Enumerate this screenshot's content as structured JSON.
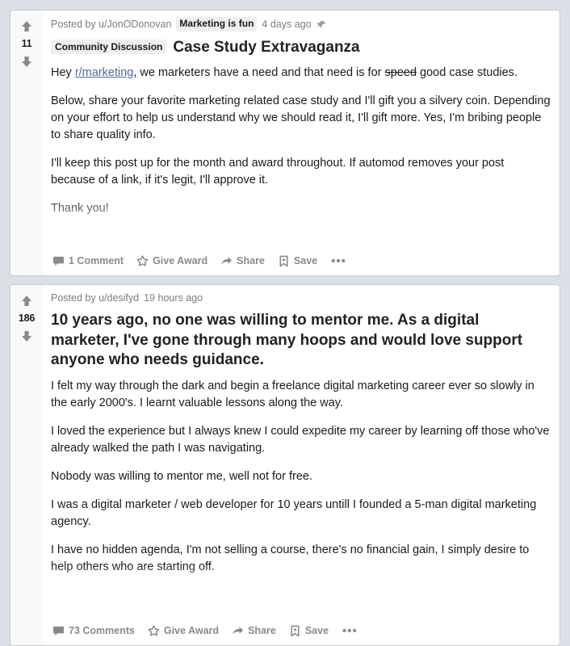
{
  "background_color": "#dae0e6",
  "card_color": "#ffffff",
  "link_color": "#4f6a9c",
  "muted_color": "#878a8c",
  "posts": [
    {
      "score": "11",
      "meta": {
        "posted_by": "Posted by u/JonODonovan",
        "author_flair": "Marketing is fun",
        "timestamp": "4 days ago",
        "pin_icon": "pin-icon"
      },
      "flair": "Community Discussion",
      "title": "Case Study Extravaganza",
      "paragraphs": [
        {
          "segments": [
            {
              "type": "text",
              "value": "Hey "
            },
            {
              "type": "link",
              "value": "r/marketing"
            },
            {
              "type": "text",
              "value": ", we marketers have a need and that need is for "
            },
            {
              "type": "strike",
              "value": "speed"
            },
            {
              "type": "text",
              "value": " good case studies."
            }
          ]
        },
        {
          "segments": [
            {
              "type": "text",
              "value": "Below, share your favorite marketing related case study and I'll gift you a silvery coin. Depending on your effort to help us understand why we should read it, I'll gift more. Yes, I'm bribing people to share quality info."
            }
          ]
        },
        {
          "segments": [
            {
              "type": "text",
              "value": "I'll keep this post up for the month and award throughout. If automod removes your post because of a link, if it's legit, I'll approve it."
            }
          ]
        },
        {
          "segments": [
            {
              "type": "text",
              "value": "Thank you!"
            }
          ]
        }
      ],
      "actions": {
        "comments": "1 Comment",
        "award": "Give Award",
        "share": "Share",
        "save": "Save",
        "more": "•••"
      }
    },
    {
      "score": "186",
      "meta": {
        "posted_by": "Posted by u/desifyd",
        "author_flair": "",
        "timestamp": "19 hours ago",
        "pin_icon": ""
      },
      "flair": "",
      "title": "10 years ago, no one was willing to mentor me. As a digital marketer, I've gone through many hoops and would love support anyone who needs guidance.",
      "paragraphs": [
        {
          "segments": [
            {
              "type": "text",
              "value": "I felt my way through the dark and begin a freelance digital marketing career ever so slowly in the early 2000's. I learnt valuable lessons along the way."
            }
          ]
        },
        {
          "segments": [
            {
              "type": "text",
              "value": "I loved the experience but I always knew I could expedite my career by learning off those who've already walked the path I was navigating."
            }
          ]
        },
        {
          "segments": [
            {
              "type": "text",
              "value": "Nobody was willing to mentor me, well not for free."
            }
          ]
        },
        {
          "segments": [
            {
              "type": "text",
              "value": "I was a digital marketer / web developer for 10 years untill I founded a 5-man digital marketing agency."
            }
          ]
        },
        {
          "segments": [
            {
              "type": "text",
              "value": "I have no hidden agenda, I'm not selling a course, there's no financial gain, I simply desire to help others who are starting off."
            }
          ]
        }
      ],
      "actions": {
        "comments": "73 Comments",
        "award": "Give Award",
        "share": "Share",
        "save": "Save",
        "more": "•••"
      }
    }
  ]
}
